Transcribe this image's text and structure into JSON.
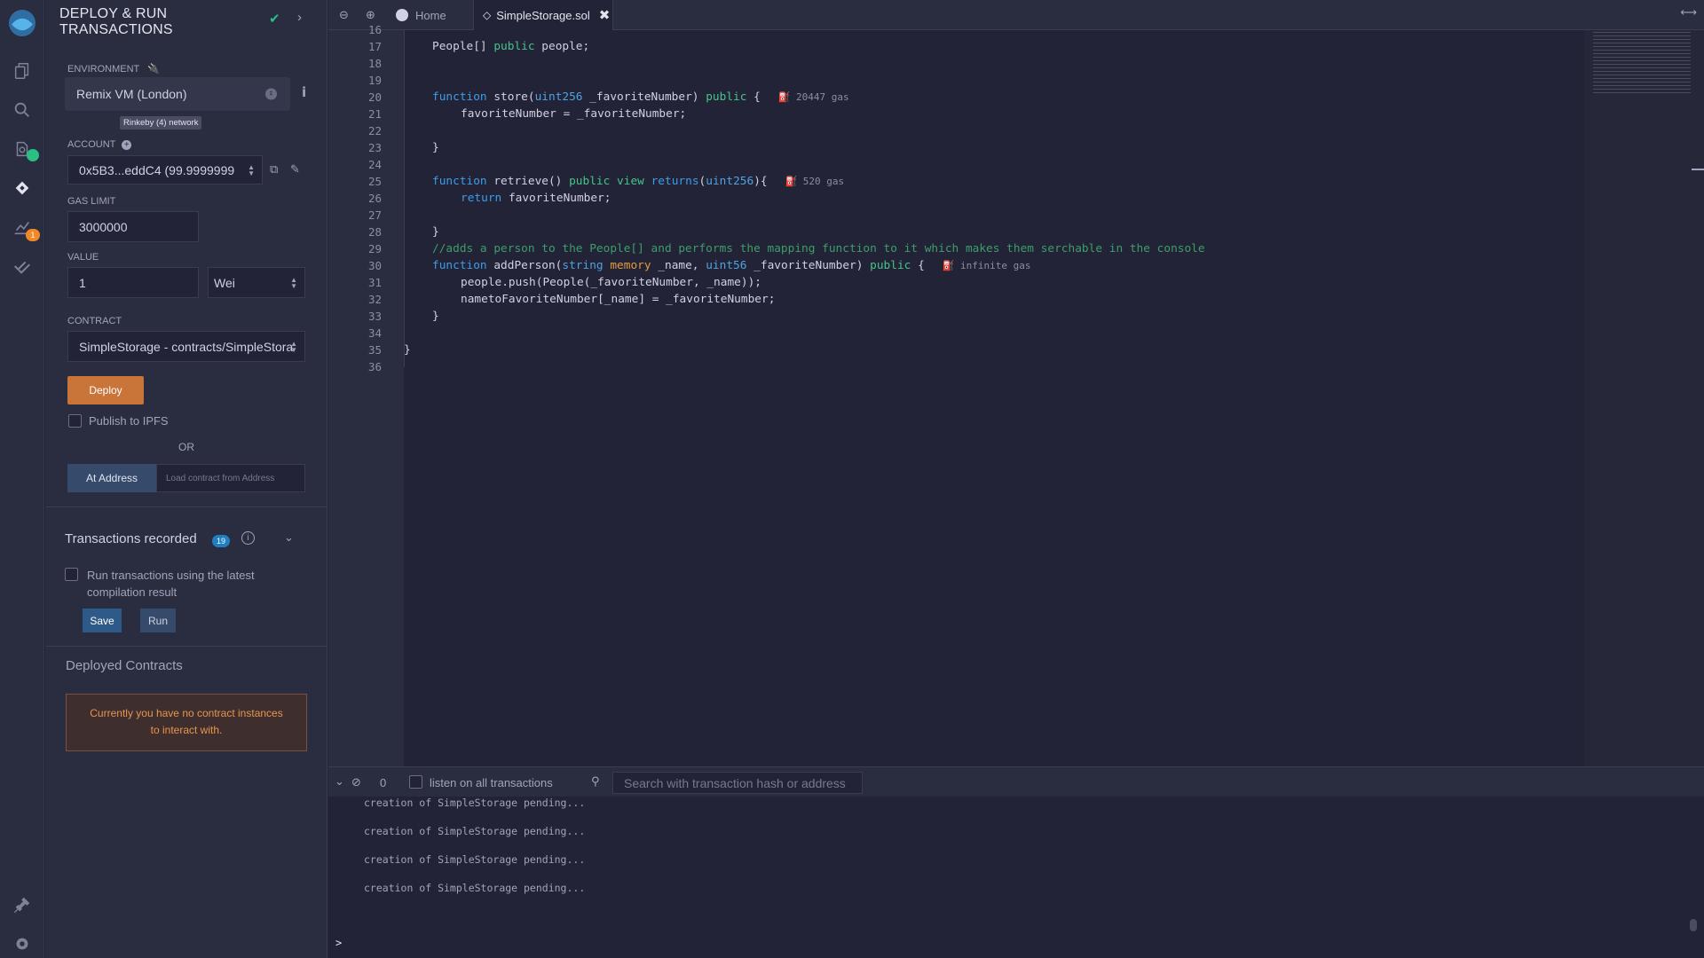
{
  "panel": {
    "title": "DEPLOY & RUN TRANSACTIONS",
    "environment_label": "ENVIRONMENT",
    "environment_value": "Remix VM (London)",
    "network_tag": "Rinkeby (4) network",
    "account_label": "ACCOUNT",
    "account_value": "0x5B3...eddC4 (99.9999999",
    "gas_limit_label": "GAS LIMIT",
    "gas_limit_value": "3000000",
    "value_label": "VALUE",
    "value_amount": "1",
    "value_unit": "Wei",
    "contract_label": "CONTRACT",
    "contract_value": "SimpleStorage - contracts/SimpleStora",
    "deploy_label": "Deploy",
    "publish_label": "Publish to IPFS",
    "or_label": "OR",
    "at_address_label": "At Address",
    "load_placeholder": "Load contract from Address",
    "tx_recorded_title": "Transactions recorded",
    "tx_recorded_count": "19",
    "run_latest_label": "Run transactions using the latest compilation result",
    "save_label": "Save",
    "run_label": "Run",
    "deployed_title": "Deployed Contracts",
    "no_instances": "Currently you have no contract instances to interact with."
  },
  "rail": {
    "analysis_badge": "1"
  },
  "tabs": [
    {
      "label": "Home",
      "icon": "remix-logo-icon"
    },
    {
      "label": "SimpleStorage.sol",
      "icon": "solidity-icon"
    }
  ],
  "editor": {
    "lines": [
      {
        "n": "16",
        "code": ""
      },
      {
        "n": "17",
        "code": "People[] public people;"
      },
      {
        "n": "18",
        "code": ""
      },
      {
        "n": "19",
        "code": ""
      },
      {
        "n": "20",
        "code": "function store(uint256 _favoriteNumber) public {",
        "gas": "20447 gas"
      },
      {
        "n": "21",
        "code": "favoriteNumber = _favoriteNumber;"
      },
      {
        "n": "22",
        "code": ""
      },
      {
        "n": "23",
        "code": "}"
      },
      {
        "n": "24",
        "code": ""
      },
      {
        "n": "25",
        "code": "function retrieve() public view returns(uint256){",
        "gas": "520 gas"
      },
      {
        "n": "26",
        "code": "return favoriteNumber;"
      },
      {
        "n": "27",
        "code": ""
      },
      {
        "n": "28",
        "code": "}"
      },
      {
        "n": "29",
        "code": "//adds a person to the People[] and performs the mapping function to it which makes them serchable in the console"
      },
      {
        "n": "30",
        "code": "function addPerson(string memory _name, uint56 _favoriteNumber) public {",
        "gas": "infinite gas"
      },
      {
        "n": "31",
        "code": "people.push(People(_favoriteNumber, _name));"
      },
      {
        "n": "32",
        "code": "nametoFavoriteNumber[_name] = _favoriteNumber;"
      },
      {
        "n": "33",
        "code": "}"
      },
      {
        "n": "34",
        "code": ""
      },
      {
        "n": "35",
        "code": "}"
      },
      {
        "n": "36",
        "code": ""
      }
    ]
  },
  "terminal": {
    "pending_count": "0",
    "listen_label": "listen on all transactions",
    "search_placeholder": "Search with transaction hash or address",
    "logs": [
      "creation of SimpleStorage pending...",
      "creation of SimpleStorage pending...",
      "creation of SimpleStorage pending...",
      "creation of SimpleStorage pending..."
    ],
    "prompt": ">"
  },
  "colors": {
    "accent_deploy": "#c97539",
    "accent_blue": "#2d5a88",
    "success": "#2bbf83",
    "warning": "#e8944e"
  }
}
